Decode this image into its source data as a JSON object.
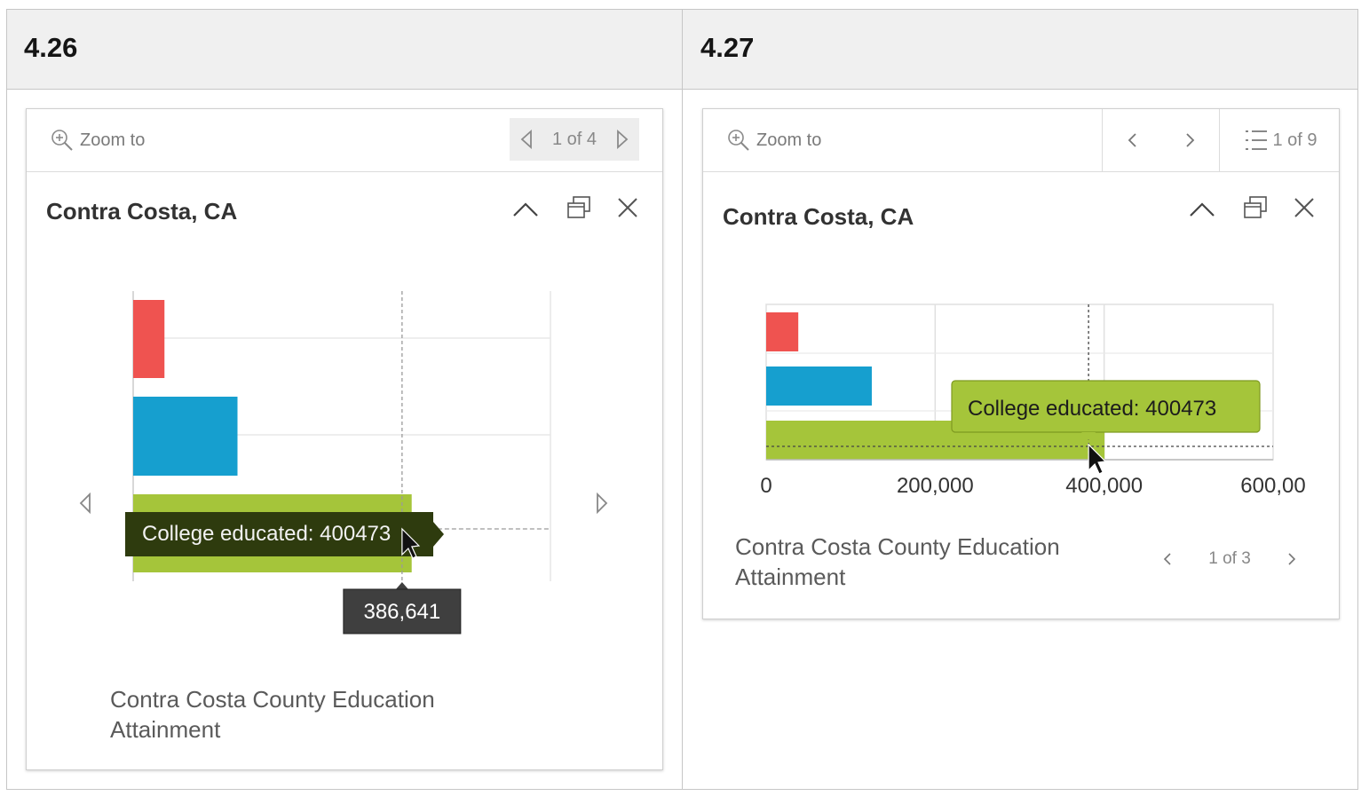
{
  "versions": {
    "left": "4.26",
    "right": "4.27"
  },
  "colors": {
    "red": "#ef5350",
    "blue": "#169fcf",
    "green": "#a5c53a",
    "tooltip_dark": "#2e3b0e",
    "tooltip_green": "#a5c53a",
    "value_box": "#3f3f3f"
  },
  "left_popup": {
    "zoom_label": "Zoom to",
    "pager_text": "1 of 4",
    "title": "Contra Costa, CA",
    "tooltip": "College educated: 400473",
    "axis_value_label": "386,641",
    "caption": "Contra Costa County Education Attainment",
    "icons": [
      "zoom-in-icon",
      "triangle-left-icon",
      "triangle-right-icon",
      "chevron-up-icon",
      "dock-icon",
      "close-icon",
      "cursor-arrow-icon"
    ]
  },
  "right_popup": {
    "zoom_label": "Zoom to",
    "feature_count": "1 of 9",
    "title": "Contra Costa, CA",
    "tooltip": "College educated: 400473",
    "caption": "Contra Costa County Education Attainment",
    "media_pager": "1 of 3",
    "icons": [
      "zoom-in-icon",
      "chevron-left-icon",
      "chevron-right-icon",
      "list-icon",
      "chevron-up-icon",
      "dock-icon",
      "close-icon",
      "cursor-arrow-icon"
    ]
  },
  "chart_data": [
    {
      "type": "bar",
      "orientation": "horizontal",
      "categories": [
        "",
        "",
        "College educated"
      ],
      "values": [
        45000,
        150000,
        400473
      ],
      "colors": [
        "#ef5350",
        "#169fcf",
        "#a5c53a"
      ],
      "xlim": [
        0,
        600000
      ],
      "crosshair_x": 386641,
      "grid": true
    },
    {
      "type": "bar",
      "orientation": "horizontal",
      "categories": [
        "",
        "",
        "College educated"
      ],
      "values": [
        38000,
        125000,
        400473
      ],
      "colors": [
        "#ef5350",
        "#169fcf",
        "#a5c53a"
      ],
      "xlim": [
        0,
        600000
      ],
      "xticks": [
        "0",
        "200,000",
        "400,000",
        "600,00"
      ],
      "grid": true
    }
  ]
}
